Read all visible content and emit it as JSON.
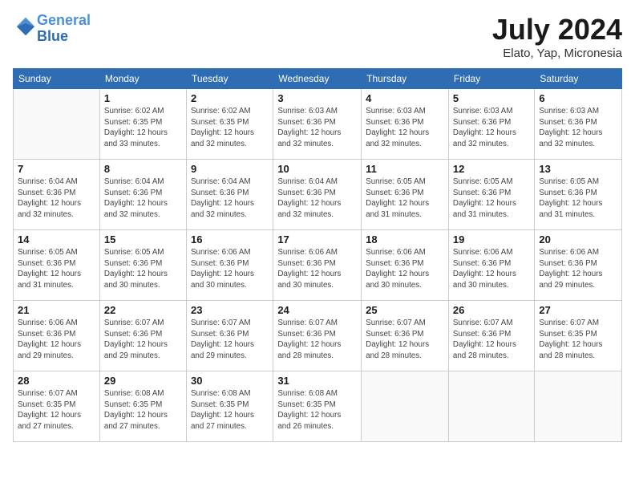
{
  "logo": {
    "line1": "General",
    "line2": "Blue"
  },
  "header": {
    "month": "July 2024",
    "location": "Elato, Yap, Micronesia"
  },
  "weekdays": [
    "Sunday",
    "Monday",
    "Tuesday",
    "Wednesday",
    "Thursday",
    "Friday",
    "Saturday"
  ],
  "weeks": [
    [
      {
        "day": "",
        "info": ""
      },
      {
        "day": "1",
        "info": "Sunrise: 6:02 AM\nSunset: 6:35 PM\nDaylight: 12 hours\nand 33 minutes."
      },
      {
        "day": "2",
        "info": "Sunrise: 6:02 AM\nSunset: 6:35 PM\nDaylight: 12 hours\nand 32 minutes."
      },
      {
        "day": "3",
        "info": "Sunrise: 6:03 AM\nSunset: 6:36 PM\nDaylight: 12 hours\nand 32 minutes."
      },
      {
        "day": "4",
        "info": "Sunrise: 6:03 AM\nSunset: 6:36 PM\nDaylight: 12 hours\nand 32 minutes."
      },
      {
        "day": "5",
        "info": "Sunrise: 6:03 AM\nSunset: 6:36 PM\nDaylight: 12 hours\nand 32 minutes."
      },
      {
        "day": "6",
        "info": "Sunrise: 6:03 AM\nSunset: 6:36 PM\nDaylight: 12 hours\nand 32 minutes."
      }
    ],
    [
      {
        "day": "7",
        "info": "Sunrise: 6:04 AM\nSunset: 6:36 PM\nDaylight: 12 hours\nand 32 minutes."
      },
      {
        "day": "8",
        "info": "Sunrise: 6:04 AM\nSunset: 6:36 PM\nDaylight: 12 hours\nand 32 minutes."
      },
      {
        "day": "9",
        "info": "Sunrise: 6:04 AM\nSunset: 6:36 PM\nDaylight: 12 hours\nand 32 minutes."
      },
      {
        "day": "10",
        "info": "Sunrise: 6:04 AM\nSunset: 6:36 PM\nDaylight: 12 hours\nand 32 minutes."
      },
      {
        "day": "11",
        "info": "Sunrise: 6:05 AM\nSunset: 6:36 PM\nDaylight: 12 hours\nand 31 minutes."
      },
      {
        "day": "12",
        "info": "Sunrise: 6:05 AM\nSunset: 6:36 PM\nDaylight: 12 hours\nand 31 minutes."
      },
      {
        "day": "13",
        "info": "Sunrise: 6:05 AM\nSunset: 6:36 PM\nDaylight: 12 hours\nand 31 minutes."
      }
    ],
    [
      {
        "day": "14",
        "info": "Sunrise: 6:05 AM\nSunset: 6:36 PM\nDaylight: 12 hours\nand 31 minutes."
      },
      {
        "day": "15",
        "info": "Sunrise: 6:05 AM\nSunset: 6:36 PM\nDaylight: 12 hours\nand 30 minutes."
      },
      {
        "day": "16",
        "info": "Sunrise: 6:06 AM\nSunset: 6:36 PM\nDaylight: 12 hours\nand 30 minutes."
      },
      {
        "day": "17",
        "info": "Sunrise: 6:06 AM\nSunset: 6:36 PM\nDaylight: 12 hours\nand 30 minutes."
      },
      {
        "day": "18",
        "info": "Sunrise: 6:06 AM\nSunset: 6:36 PM\nDaylight: 12 hours\nand 30 minutes."
      },
      {
        "day": "19",
        "info": "Sunrise: 6:06 AM\nSunset: 6:36 PM\nDaylight: 12 hours\nand 30 minutes."
      },
      {
        "day": "20",
        "info": "Sunrise: 6:06 AM\nSunset: 6:36 PM\nDaylight: 12 hours\nand 29 minutes."
      }
    ],
    [
      {
        "day": "21",
        "info": "Sunrise: 6:06 AM\nSunset: 6:36 PM\nDaylight: 12 hours\nand 29 minutes."
      },
      {
        "day": "22",
        "info": "Sunrise: 6:07 AM\nSunset: 6:36 PM\nDaylight: 12 hours\nand 29 minutes."
      },
      {
        "day": "23",
        "info": "Sunrise: 6:07 AM\nSunset: 6:36 PM\nDaylight: 12 hours\nand 29 minutes."
      },
      {
        "day": "24",
        "info": "Sunrise: 6:07 AM\nSunset: 6:36 PM\nDaylight: 12 hours\nand 28 minutes."
      },
      {
        "day": "25",
        "info": "Sunrise: 6:07 AM\nSunset: 6:36 PM\nDaylight: 12 hours\nand 28 minutes."
      },
      {
        "day": "26",
        "info": "Sunrise: 6:07 AM\nSunset: 6:36 PM\nDaylight: 12 hours\nand 28 minutes."
      },
      {
        "day": "27",
        "info": "Sunrise: 6:07 AM\nSunset: 6:35 PM\nDaylight: 12 hours\nand 28 minutes."
      }
    ],
    [
      {
        "day": "28",
        "info": "Sunrise: 6:07 AM\nSunset: 6:35 PM\nDaylight: 12 hours\nand 27 minutes."
      },
      {
        "day": "29",
        "info": "Sunrise: 6:08 AM\nSunset: 6:35 PM\nDaylight: 12 hours\nand 27 minutes."
      },
      {
        "day": "30",
        "info": "Sunrise: 6:08 AM\nSunset: 6:35 PM\nDaylight: 12 hours\nand 27 minutes."
      },
      {
        "day": "31",
        "info": "Sunrise: 6:08 AM\nSunset: 6:35 PM\nDaylight: 12 hours\nand 26 minutes."
      },
      {
        "day": "",
        "info": ""
      },
      {
        "day": "",
        "info": ""
      },
      {
        "day": "",
        "info": ""
      }
    ]
  ]
}
